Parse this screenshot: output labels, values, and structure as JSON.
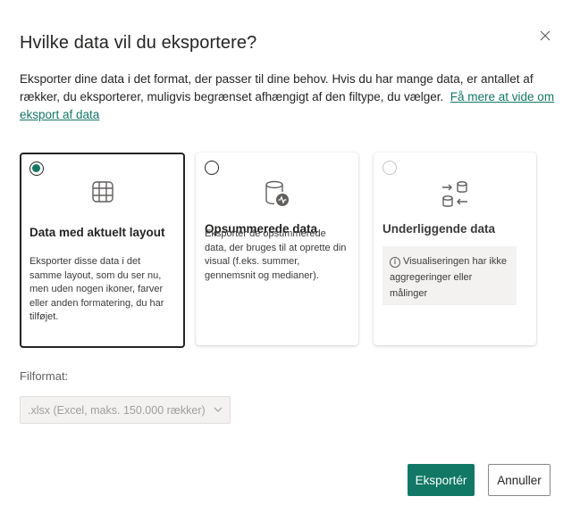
{
  "dialog": {
    "title": "Hvilke data vil du eksportere?",
    "description": "Eksporter dine data i det format, der passer til dine behov. Hvis du har mange data, er antallet af rækker, du eksporterer, muligvis begrænset afhængigt af den filtype, du vælger.",
    "learn_more_link": "Få mere at vide om eksport af data",
    "close_icon": "close-icon"
  },
  "options": [
    {
      "id": "current-layout",
      "selected": true,
      "disabled": false,
      "icon": "table-grid-icon",
      "title": "Data med aktuelt layout",
      "text": "Eksporter disse data i det samme layout, som du ser nu, men uden nogen ikoner, farver eller anden formatering, du har tilføjet."
    },
    {
      "id": "summarized",
      "selected": false,
      "disabled": false,
      "icon": "database-pulse-icon",
      "title": "Opsummerede data",
      "text": "Eksporter de opsummerede data, der bruges til at oprette din visual (f.eks. summer, gennemsnit og medianer)."
    },
    {
      "id": "underlying",
      "selected": false,
      "disabled": true,
      "icon": "database-exchange-icon",
      "title": "Underliggende data",
      "info_text": "Visualiseringen har ikke aggregeringer eller målinger"
    }
  ],
  "file_format": {
    "label": "Filformat:",
    "value": ".xlsx (Excel, maks. 150.000 rækker)",
    "disabled": true
  },
  "buttons": {
    "export_label": "Eksportér",
    "cancel_label": "Annuller"
  },
  "colors": {
    "accent": "#117865",
    "text": "#252423",
    "muted": "#605e5c",
    "disabled_bg": "#f3f2f1"
  }
}
